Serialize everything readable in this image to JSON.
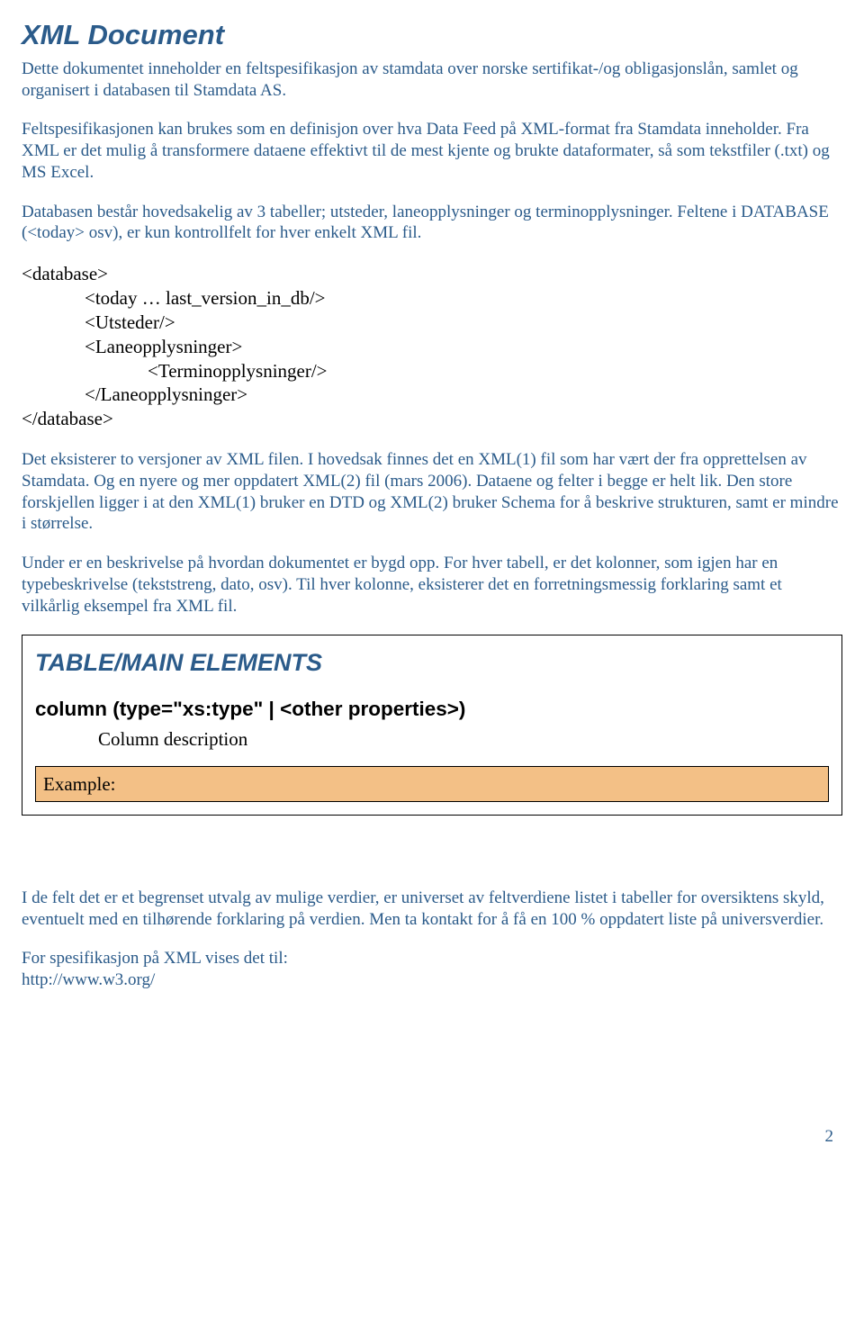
{
  "heading": "XML Document",
  "para1": "Dette dokumentet inneholder en feltspesifikasjon av stamdata over norske sertifikat-/og obligasjonslån, samlet og organisert i databasen til Stamdata AS.",
  "para2": "Feltspesifikasjonen kan brukes som en definisjon over hva  Data Feed på XML-format fra Stamdata inneholder. Fra XML er det mulig å transformere dataene effektivt til de mest kjente og brukte dataformater, så som tekstfiler (.txt) og MS Excel.",
  "para3": "Databasen består hovedsakelig av 3 tabeller; utsteder, laneopplysninger og terminopplysninger. Feltene i DATABASE (<today> osv), er kun kontrollfelt for hver enkelt XML fil.",
  "xml": {
    "l1": "<database>",
    "l2": "<today … last_version_in_db/>",
    "l3": "<Utsteder/>",
    "l4": "<Laneopplysninger>",
    "l5": "<Terminopplysninger/>",
    "l6": "</Laneopplysninger>",
    "l7": "</database>"
  },
  "para4": "Det eksisterer to versjoner av XML filen. I hovedsak finnes det en XML(1) fil som har vært der fra opprettelsen av Stamdata. Og en nyere og mer oppdatert XML(2) fil (mars 2006). Dataene og felter i begge er helt lik. Den store forskjellen ligger i at den XML(1) bruker en DTD og XML(2) bruker Schema for å beskrive strukturen, samt er mindre i størrelse.",
  "para5": "Under er en beskrivelse på hvordan dokumentet er bygd opp. For hver tabell, er det kolonner, som igjen har en typebeskrivelse (tekststreng, dato, osv). Til hver kolonne, eksisterer det en forretningsmessig forklaring samt et vilkårlig eksempel fra XML fil.",
  "box": {
    "title": "TABLE/MAIN ELEMENTS",
    "column": "column (type=\"xs:type\" | <other properties>)",
    "desc": "Column description",
    "example": "Example:"
  },
  "para6": "I de felt det er et begrenset utvalg av mulige verdier, er universet av feltverdiene listet i tabeller for oversiktens skyld, eventuelt med en tilhørende forklaring på verdien. Men ta kontakt for å få en 100 % oppdatert liste på universverdier.",
  "para7a": "For spesifikasjon på XML vises det til:",
  "para7b": "http://www.w3.org/",
  "page_number": "2"
}
